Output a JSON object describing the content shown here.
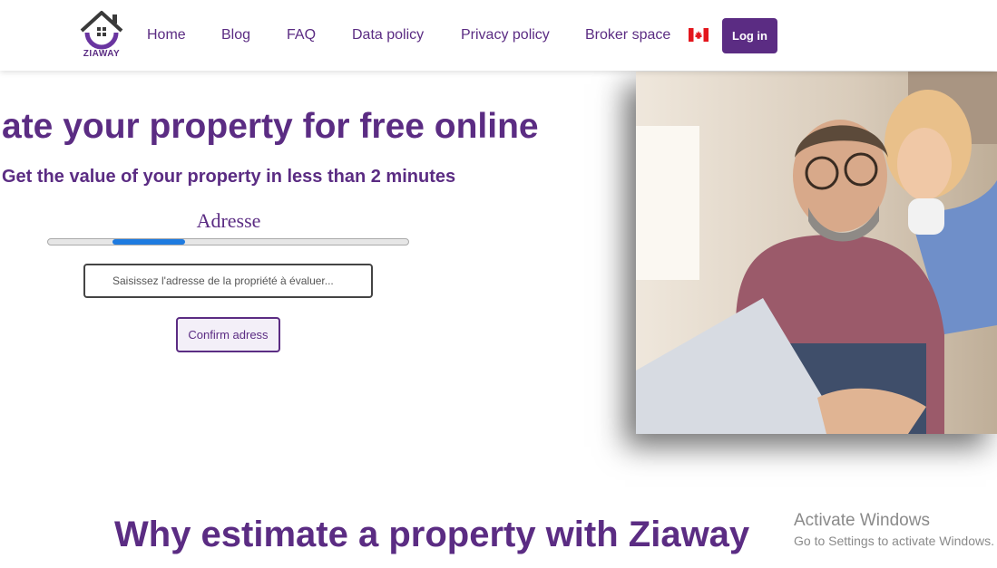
{
  "brand": {
    "name": "ZIAWAY",
    "accent": "#5b2c83"
  },
  "nav": {
    "items": [
      {
        "label": "Home"
      },
      {
        "label": "Blog"
      },
      {
        "label": "FAQ"
      },
      {
        "label": "Data policy"
      },
      {
        "label": "Privacy policy"
      },
      {
        "label": "Broker space"
      }
    ],
    "flag_icon": "canada-flag-icon",
    "login_label": "Log in"
  },
  "hero": {
    "title": "ate your property for free online",
    "subtitle": "Get the value of your property in less than 2 minutes",
    "step_label": "Adresse",
    "progress": {
      "start": 0.18,
      "end": 0.38,
      "color": "#1e7be0"
    },
    "address_placeholder": "Saisissez l'adresse de la propriété à évaluer...",
    "confirm_label": "Confirm adress"
  },
  "section": {
    "why_title": "Why estimate a property with Ziaway"
  },
  "watermark": {
    "title": "Activate Windows",
    "subtitle": "Go to Settings to activate Windows."
  }
}
